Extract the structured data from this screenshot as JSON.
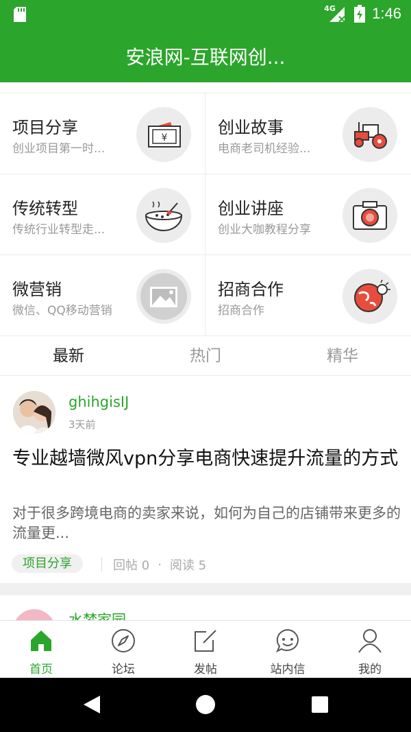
{
  "status_bar": {
    "network": "4G",
    "time": "1:46"
  },
  "app_bar": {
    "title": "安浪网-互联网创..."
  },
  "categories": [
    {
      "title": "项目分享",
      "subtitle": "创业项目第一时...",
      "icon": "cash-register-icon"
    },
    {
      "title": "创业故事",
      "subtitle": "电商老司机经验...",
      "icon": "tractor-icon"
    },
    {
      "title": "传统转型",
      "subtitle": "传统行业转型走...",
      "icon": "soup-bowl-icon"
    },
    {
      "title": "创业讲座",
      "subtitle": "创业大咖教程分享",
      "icon": "camera-icon"
    },
    {
      "title": "微营销",
      "subtitle": "微信、QQ移动营销",
      "icon": "image-placeholder-icon"
    },
    {
      "title": "招商合作",
      "subtitle": "招商合作",
      "icon": "globe-icon"
    }
  ],
  "tabs": [
    {
      "label": "最新",
      "active": true
    },
    {
      "label": "热门",
      "active": false
    },
    {
      "label": "精华",
      "active": false
    }
  ],
  "posts": [
    {
      "user": "ghihgisIJ",
      "time": "3天前",
      "title": "专业越墙微风vpn分享电商快速提升流量的方式",
      "excerpt": "对于很多跨境电商的卖家来说，如何为自己的店铺带来更多的流量更...",
      "tag": "项目分享",
      "replies": "回帖 0",
      "reads": "阅读 5"
    },
    {
      "user": "水梦家园"
    }
  ],
  "bottom_nav": [
    {
      "label": "首页",
      "icon": "home-icon",
      "active": true
    },
    {
      "label": "论坛",
      "icon": "compass-icon",
      "active": false
    },
    {
      "label": "发帖",
      "icon": "edit-icon",
      "active": false
    },
    {
      "label": "站内信",
      "icon": "smiley-message-icon",
      "active": false
    },
    {
      "label": "我的",
      "icon": "person-icon",
      "active": false
    }
  ],
  "colors": {
    "brand": "#2ba52b",
    "accent_red": "#e74c3c"
  }
}
